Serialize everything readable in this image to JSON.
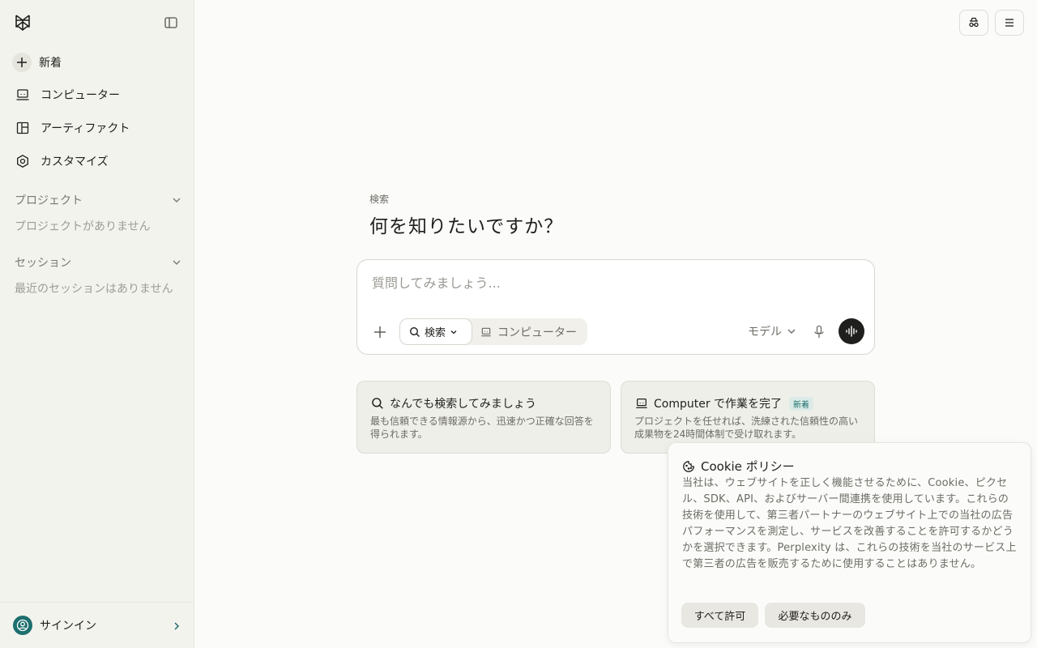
{
  "sidebar": {
    "new_label": "新着",
    "items": [
      {
        "label": "コンピューター",
        "icon": "computer-icon"
      },
      {
        "label": "アーティファクト",
        "icon": "artifact-icon"
      },
      {
        "label": "カスタマイズ",
        "icon": "customize-icon"
      }
    ],
    "projects": {
      "title": "プロジェクト",
      "empty": "プロジェクトがありません"
    },
    "sessions": {
      "title": "セッション",
      "empty": "最近のセッションはありません"
    },
    "signin_label": "サインイン"
  },
  "main": {
    "search_label": "検索",
    "headline": "何を知りたいですか？",
    "composer": {
      "placeholder": "質問してみましょう...",
      "mode_search": "検索",
      "mode_computer": "コンピューター",
      "model_label": "モデル"
    },
    "cards": [
      {
        "title": "なんでも検索してみましょう",
        "desc": "最も信頼できる情報源から、迅速かつ正確な回答を得られます。"
      },
      {
        "title": "Computer で作業を完了",
        "badge": "新着",
        "desc": "プロジェクトを任せれば、洗練された信頼性の高い成果物を24時間体制で受け取れます。"
      }
    ]
  },
  "cookie": {
    "title": "Cookie ポリシー",
    "body": "当社は、ウェブサイトを正しく機能させるために、Cookie、ピクセル、SDK、API、およびサーバー間連携を使用しています。これらの技術を使用して、第三者パートナーのウェブサイト上での当社の広告パフォーマンスを測定し、サービスを改善することを許可するかどうかを選択できます。Perplexity は、これらの技術を当社のサービス上で第三者の広告を販売するために使用することはありません。",
    "allow_all": "すべて許可",
    "necessary_only": "必要なもののみ"
  },
  "colors": {
    "accent": "#1d6f6e",
    "sidebar_bg": "#f3f3ee",
    "page_bg": "#fbfbf9"
  }
}
